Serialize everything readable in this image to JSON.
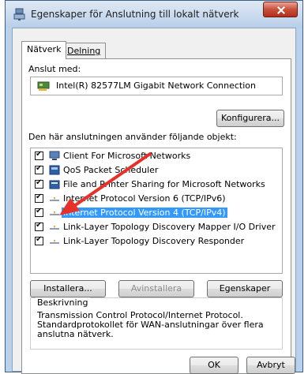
{
  "window": {
    "title": "Egenskaper för Anslutning till lokalt nätverk"
  },
  "tabs": [
    {
      "label": "Nätverk"
    },
    {
      "label": "Delning"
    }
  ],
  "connect_using": {
    "label": "Anslut med:",
    "adapter": "Intel(R) 82577LM Gigabit Network Connection"
  },
  "buttons": {
    "configure": "Konfigurera...",
    "install": "Installera...",
    "uninstall": "Avinstallera",
    "properties": "Egenskaper",
    "ok": "OK",
    "cancel": "Avbryt"
  },
  "items_label": "Den här anslutningen använder följande objekt:",
  "items": [
    {
      "label": "Client For Microsoft Networks",
      "checked": true,
      "icon": "client-icon"
    },
    {
      "label": "QoS Packet Scheduler",
      "checked": true,
      "icon": "qos-icon"
    },
    {
      "label": "File and Printer Sharing for Microsoft Networks",
      "checked": true,
      "icon": "sharing-icon"
    },
    {
      "label": "Internet Protocol Version 6 (TCP/IPv6)",
      "checked": true,
      "icon": "protocol-icon"
    },
    {
      "label": "Internet Protocol Version 4 (TCP/IPv4)",
      "checked": true,
      "icon": "protocol-icon",
      "selected": true
    },
    {
      "label": "Link-Layer Topology Discovery Mapper I/O Driver",
      "checked": true,
      "icon": "protocol-icon"
    },
    {
      "label": "Link-Layer Topology Discovery Responder",
      "checked": true,
      "icon": "protocol-icon"
    }
  ],
  "description": {
    "title": "Beskrivning",
    "text": "Transmission Control Protocol/Internet Protocol. Standardprotokollet för WAN-anslutningar över flera anslutna nätverk."
  },
  "colors": {
    "selection": "#3399ff",
    "arrow": "#e8302a"
  }
}
